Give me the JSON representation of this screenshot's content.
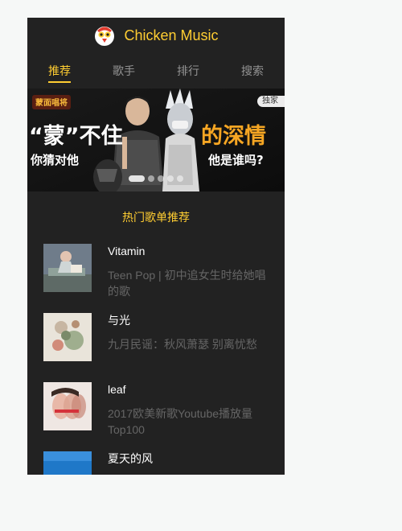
{
  "header": {
    "title": "Chicken Music",
    "logo_icon": "chicken-logo-icon"
  },
  "tabs": [
    {
      "label": "推荐",
      "active": true
    },
    {
      "label": "歌手",
      "active": false
    },
    {
      "label": "排行",
      "active": false
    },
    {
      "label": "搜索",
      "active": false
    }
  ],
  "banner": {
    "badge": "独家",
    "show_logo": "蒙面唱将",
    "headline_left": "“蒙”不住",
    "headline_right": "的深情",
    "sub_left": "你猜对他",
    "sub_right": "他是谁吗?",
    "slide_count": 5,
    "active_slide": 0
  },
  "section": {
    "title": "热门歌单推荐"
  },
  "playlists": [
    {
      "name": "Vitamin",
      "desc": "Teen Pop | 初中追女生时给她唱的歌"
    },
    {
      "name": "与光",
      "desc": "九月民谣：秋风萧瑟 别离忧愁"
    },
    {
      "name": "leaf",
      "desc": "2017欧美新歌Youtube播放量Top100"
    },
    {
      "name": "夏天的风",
      "desc": ""
    }
  ],
  "colors": {
    "accent": "#ffcd32",
    "background": "#222222"
  }
}
